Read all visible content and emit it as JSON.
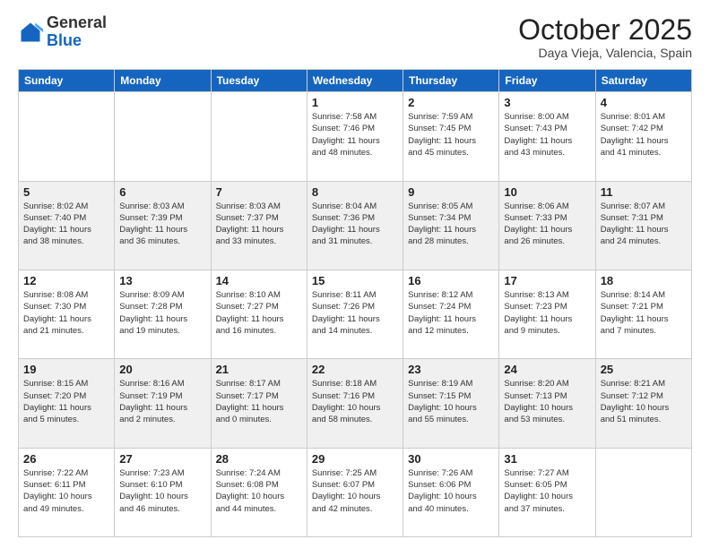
{
  "logo": {
    "general": "General",
    "blue": "Blue"
  },
  "header": {
    "month": "October 2025",
    "location": "Daya Vieja, Valencia, Spain"
  },
  "weekdays": [
    "Sunday",
    "Monday",
    "Tuesday",
    "Wednesday",
    "Thursday",
    "Friday",
    "Saturday"
  ],
  "weeks": [
    [
      {
        "day": "",
        "info": ""
      },
      {
        "day": "",
        "info": ""
      },
      {
        "day": "",
        "info": ""
      },
      {
        "day": "1",
        "info": "Sunrise: 7:58 AM\nSunset: 7:46 PM\nDaylight: 11 hours\nand 48 minutes."
      },
      {
        "day": "2",
        "info": "Sunrise: 7:59 AM\nSunset: 7:45 PM\nDaylight: 11 hours\nand 45 minutes."
      },
      {
        "day": "3",
        "info": "Sunrise: 8:00 AM\nSunset: 7:43 PM\nDaylight: 11 hours\nand 43 minutes."
      },
      {
        "day": "4",
        "info": "Sunrise: 8:01 AM\nSunset: 7:42 PM\nDaylight: 11 hours\nand 41 minutes."
      }
    ],
    [
      {
        "day": "5",
        "info": "Sunrise: 8:02 AM\nSunset: 7:40 PM\nDaylight: 11 hours\nand 38 minutes."
      },
      {
        "day": "6",
        "info": "Sunrise: 8:03 AM\nSunset: 7:39 PM\nDaylight: 11 hours\nand 36 minutes."
      },
      {
        "day": "7",
        "info": "Sunrise: 8:03 AM\nSunset: 7:37 PM\nDaylight: 11 hours\nand 33 minutes."
      },
      {
        "day": "8",
        "info": "Sunrise: 8:04 AM\nSunset: 7:36 PM\nDaylight: 11 hours\nand 31 minutes."
      },
      {
        "day": "9",
        "info": "Sunrise: 8:05 AM\nSunset: 7:34 PM\nDaylight: 11 hours\nand 28 minutes."
      },
      {
        "day": "10",
        "info": "Sunrise: 8:06 AM\nSunset: 7:33 PM\nDaylight: 11 hours\nand 26 minutes."
      },
      {
        "day": "11",
        "info": "Sunrise: 8:07 AM\nSunset: 7:31 PM\nDaylight: 11 hours\nand 24 minutes."
      }
    ],
    [
      {
        "day": "12",
        "info": "Sunrise: 8:08 AM\nSunset: 7:30 PM\nDaylight: 11 hours\nand 21 minutes."
      },
      {
        "day": "13",
        "info": "Sunrise: 8:09 AM\nSunset: 7:28 PM\nDaylight: 11 hours\nand 19 minutes."
      },
      {
        "day": "14",
        "info": "Sunrise: 8:10 AM\nSunset: 7:27 PM\nDaylight: 11 hours\nand 16 minutes."
      },
      {
        "day": "15",
        "info": "Sunrise: 8:11 AM\nSunset: 7:26 PM\nDaylight: 11 hours\nand 14 minutes."
      },
      {
        "day": "16",
        "info": "Sunrise: 8:12 AM\nSunset: 7:24 PM\nDaylight: 11 hours\nand 12 minutes."
      },
      {
        "day": "17",
        "info": "Sunrise: 8:13 AM\nSunset: 7:23 PM\nDaylight: 11 hours\nand 9 minutes."
      },
      {
        "day": "18",
        "info": "Sunrise: 8:14 AM\nSunset: 7:21 PM\nDaylight: 11 hours\nand 7 minutes."
      }
    ],
    [
      {
        "day": "19",
        "info": "Sunrise: 8:15 AM\nSunset: 7:20 PM\nDaylight: 11 hours\nand 5 minutes."
      },
      {
        "day": "20",
        "info": "Sunrise: 8:16 AM\nSunset: 7:19 PM\nDaylight: 11 hours\nand 2 minutes."
      },
      {
        "day": "21",
        "info": "Sunrise: 8:17 AM\nSunset: 7:17 PM\nDaylight: 11 hours\nand 0 minutes."
      },
      {
        "day": "22",
        "info": "Sunrise: 8:18 AM\nSunset: 7:16 PM\nDaylight: 10 hours\nand 58 minutes."
      },
      {
        "day": "23",
        "info": "Sunrise: 8:19 AM\nSunset: 7:15 PM\nDaylight: 10 hours\nand 55 minutes."
      },
      {
        "day": "24",
        "info": "Sunrise: 8:20 AM\nSunset: 7:13 PM\nDaylight: 10 hours\nand 53 minutes."
      },
      {
        "day": "25",
        "info": "Sunrise: 8:21 AM\nSunset: 7:12 PM\nDaylight: 10 hours\nand 51 minutes."
      }
    ],
    [
      {
        "day": "26",
        "info": "Sunrise: 7:22 AM\nSunset: 6:11 PM\nDaylight: 10 hours\nand 49 minutes."
      },
      {
        "day": "27",
        "info": "Sunrise: 7:23 AM\nSunset: 6:10 PM\nDaylight: 10 hours\nand 46 minutes."
      },
      {
        "day": "28",
        "info": "Sunrise: 7:24 AM\nSunset: 6:08 PM\nDaylight: 10 hours\nand 44 minutes."
      },
      {
        "day": "29",
        "info": "Sunrise: 7:25 AM\nSunset: 6:07 PM\nDaylight: 10 hours\nand 42 minutes."
      },
      {
        "day": "30",
        "info": "Sunrise: 7:26 AM\nSunset: 6:06 PM\nDaylight: 10 hours\nand 40 minutes."
      },
      {
        "day": "31",
        "info": "Sunrise: 7:27 AM\nSunset: 6:05 PM\nDaylight: 10 hours\nand 37 minutes."
      },
      {
        "day": "",
        "info": ""
      }
    ]
  ]
}
